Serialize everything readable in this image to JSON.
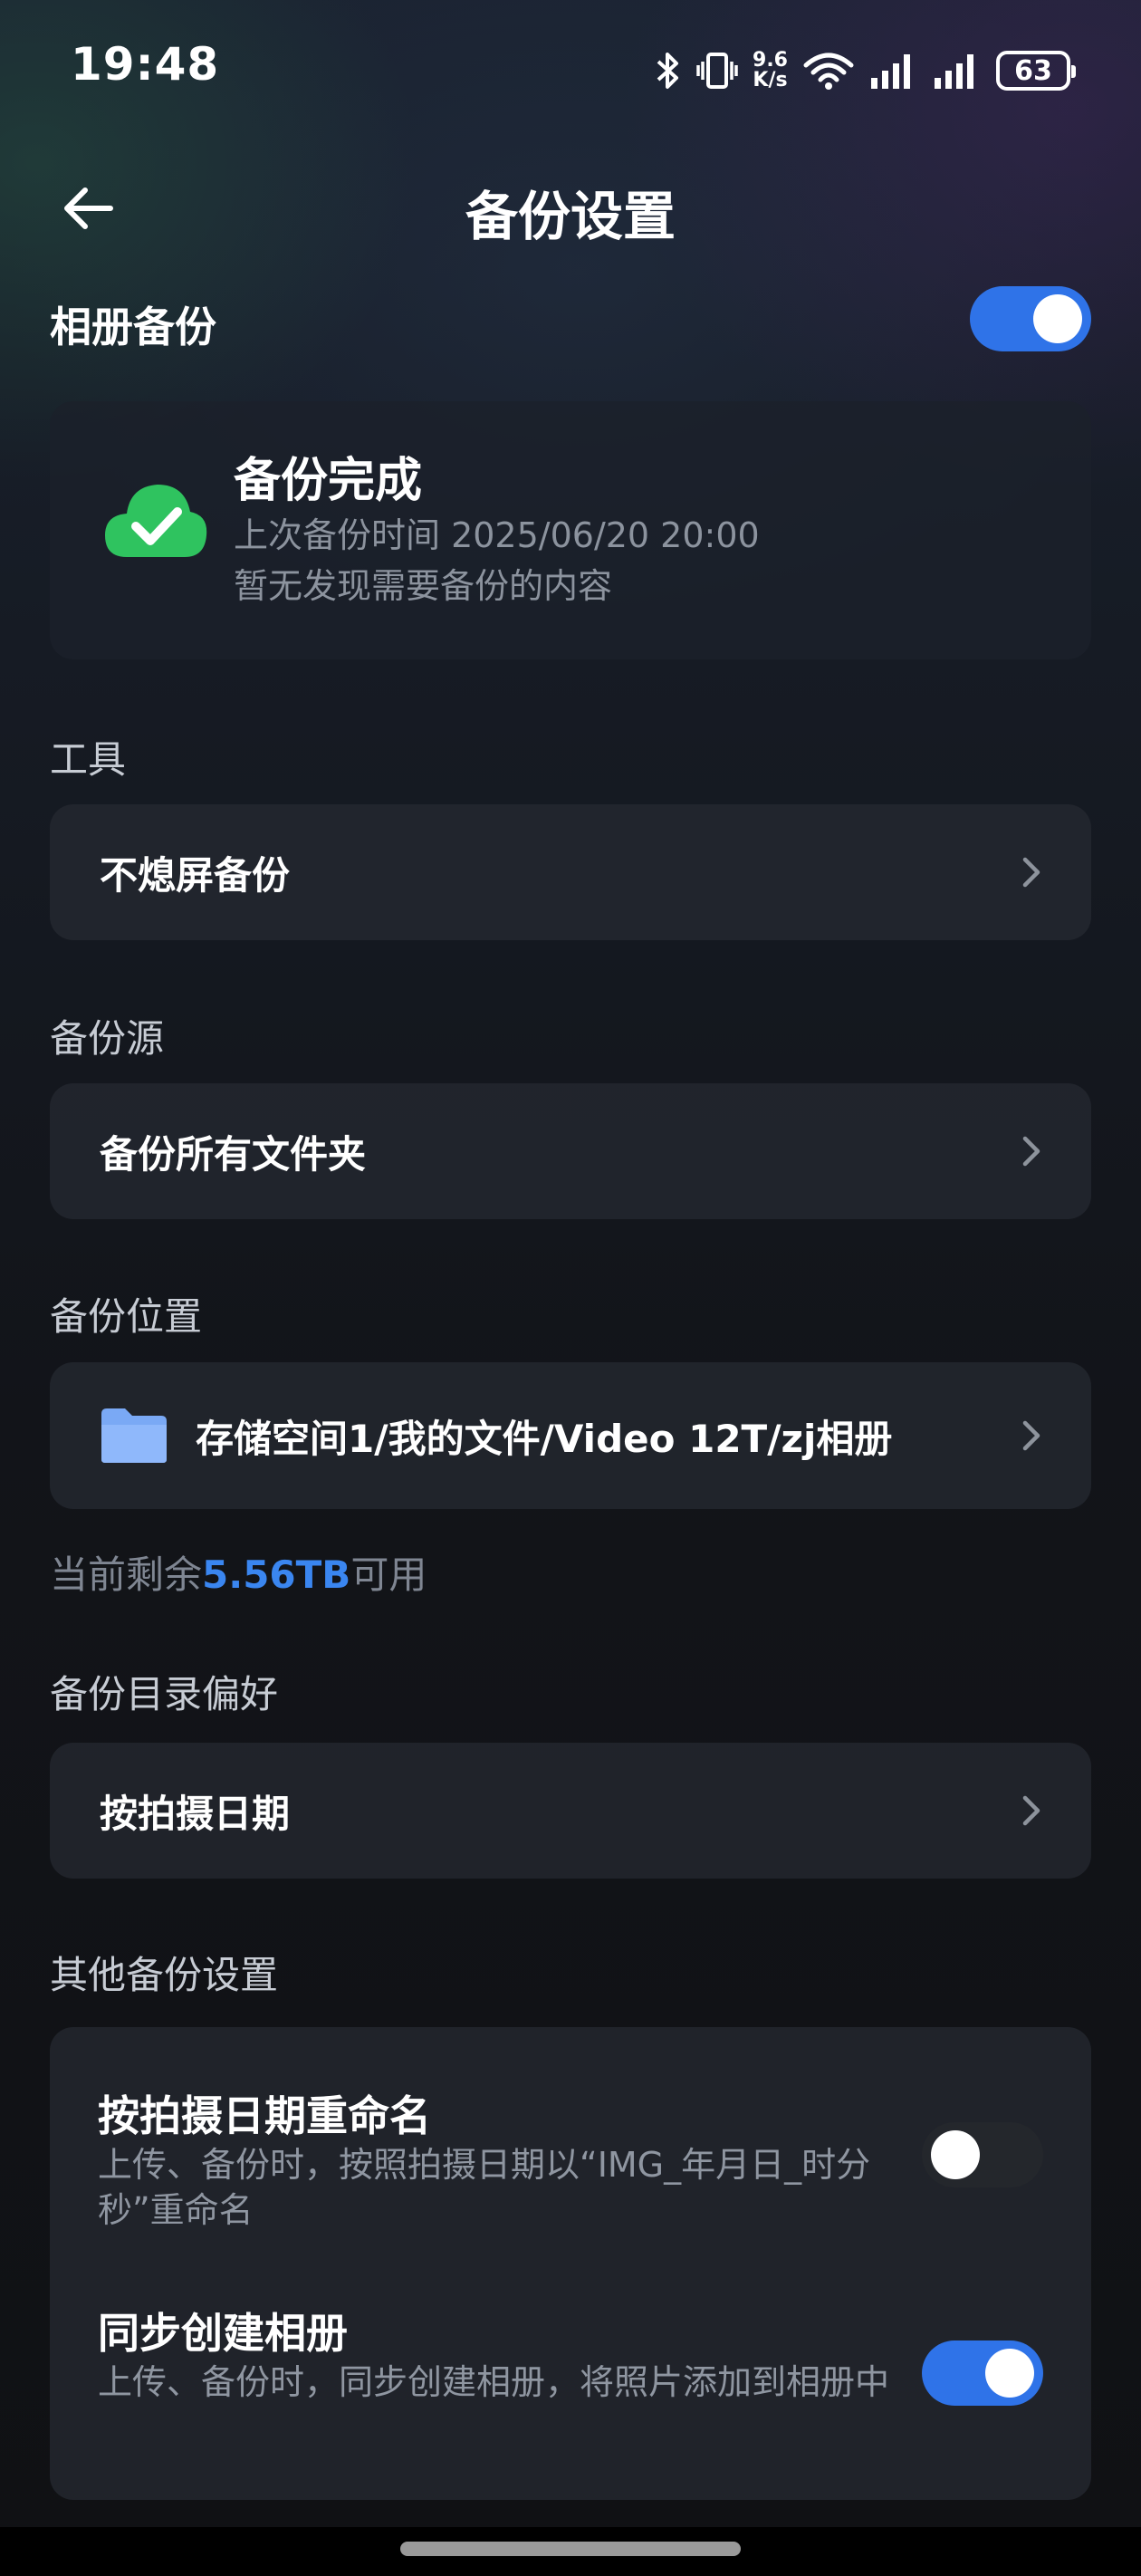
{
  "status_bar": {
    "time": "19:48",
    "net_speed_value": "9.6",
    "net_speed_unit": "K/s",
    "battery": "63"
  },
  "header": {
    "title": "备份设置"
  },
  "album_backup": {
    "label": "相册备份",
    "enabled": true
  },
  "status_card": {
    "title": "备份完成",
    "last_backup": "上次备份时间 2025/06/20 20:00",
    "message": "暂无发现需要备份的内容"
  },
  "tools": {
    "label": "工具",
    "item": "不熄屏备份"
  },
  "source": {
    "label": "备份源",
    "item": "备份所有文件夹"
  },
  "location": {
    "label": "备份位置",
    "path": "存储空间1/我的文件/Video 12T/zj相册",
    "remaining_prefix": "当前剩余",
    "remaining_value": "5.56TB",
    "remaining_suffix": "可用"
  },
  "directory": {
    "label": "备份目录偏好",
    "item": "按拍摄日期"
  },
  "other": {
    "label": "其他备份设置",
    "rename": {
      "title": "按拍摄日期重命名",
      "desc": "上传、备份时，按照拍摄日期以“IMG_年月日_时分秒”重命名",
      "enabled": false
    },
    "album_sync": {
      "title": "同步创建相册",
      "desc": "上传、备份时，同步创建相册，将照片添加到相册中",
      "enabled": true
    }
  },
  "colors": {
    "accent": "#2f73e8",
    "success": "#2fc35f",
    "link_blue": "#3a86f0"
  }
}
